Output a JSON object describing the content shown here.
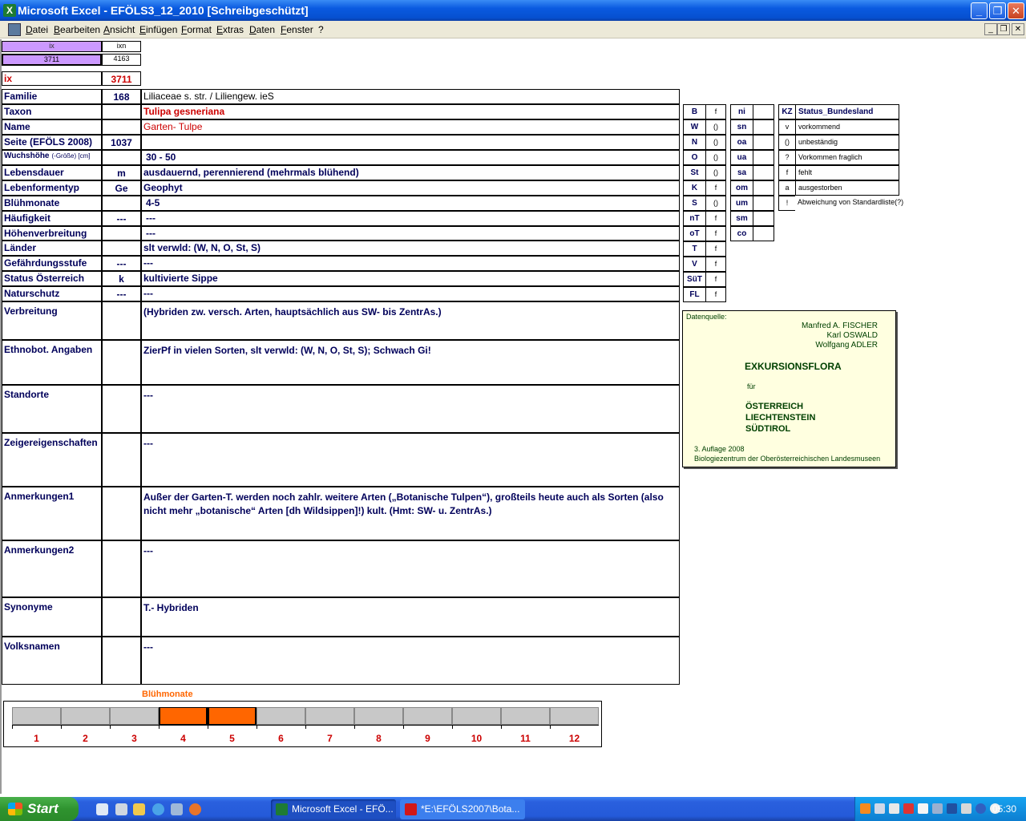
{
  "window": {
    "title": "Microsoft Excel - EFÖLS3_12_2010  [Schreibgeschützt]",
    "minimize": "_",
    "restore": "❐",
    "close": "✕"
  },
  "menu": [
    "Datei",
    "Bearbeiten",
    "Ansicht",
    "Einfügen",
    "Format",
    "Extras",
    "Daten",
    "Fenster",
    "?"
  ],
  "mdi": {
    "minimize": "_",
    "restore": "❐",
    "close": "✕"
  },
  "topcells": {
    "ix_head": "ix",
    "ixn_head": "ixn",
    "ix_val": "3711",
    "ixn_val": "4163"
  },
  "ix_row": {
    "label": "ix",
    "value": "3711"
  },
  "fields": [
    {
      "label": "Familie",
      "code": "168",
      "value": "Liliaceae s. str. / Liliengew. ieS"
    },
    {
      "label": "Taxon",
      "code": "",
      "value": "Tulipa gesneriana"
    },
    {
      "label": "Name",
      "code": "",
      "value": "Garten- Tulpe"
    },
    {
      "label": "Seite (EFÖLS 2008)",
      "code": "1037",
      "value": ""
    },
    {
      "label": "Wuchshöhe",
      "label_small": "(-Größe) [cm]",
      "code": "",
      "value": "30 - 50"
    },
    {
      "label": "Lebensdauer",
      "code": "m",
      "value": "ausdauernd, perennierend (mehrmals blühend)"
    },
    {
      "label": "Lebenformentyp",
      "code": "Ge",
      "value": "Geophyt"
    },
    {
      "label": "Blühmonate",
      "code": "",
      "value": "4-5"
    },
    {
      "label": "Häufigkeit",
      "code": "---",
      "value": "---"
    },
    {
      "label": "Höhenverbreitung",
      "code": "",
      "value": "---"
    },
    {
      "label": "Länder",
      "code": "",
      "value": "slt verwld: (W, N, O, St, S)"
    },
    {
      "label": "Gefährdungsstufe",
      "code": "---",
      "value": "---"
    },
    {
      "label": "Status Österreich",
      "code": "k",
      "value": "kultivierte Sippe"
    },
    {
      "label": "Naturschutz",
      "code": "---",
      "value": "---"
    }
  ],
  "bigfields": [
    {
      "label": "Verbreitung",
      "value": "(Hybriden zw. versch. Arten, hauptsächlich aus SW- bis ZentrAs.)"
    },
    {
      "label": "Ethnobot. Angaben",
      "value": "ZierPf in vielen Sorten, slt verwld: (W, N, O, St, S); Schwach Gi!"
    },
    {
      "label": "Standorte",
      "value": "---"
    },
    {
      "label": "Zeigereigenschaften",
      "value": "---"
    },
    {
      "label": "Anmerkungen1",
      "value": "Außer der Garten-T. werden noch zahlr. weitere Arten („Botanische Tulpen“), großteils heute auch als Sorten (also",
      "value2": "nicht mehr „botanische“ Arten [dh Wildsippen]!) kult. (Hmt: SW- u. ZentrAs.)"
    },
    {
      "label": "Anmerkungen2",
      "value": "---"
    },
    {
      "label": "Synonyme",
      "value": "T.- Hybriden"
    },
    {
      "label": "Volksnamen",
      "value": "---"
    }
  ],
  "laender": [
    {
      "code": "B",
      "val": "f"
    },
    {
      "code": "W",
      "val": "()"
    },
    {
      "code": "N",
      "val": "()"
    },
    {
      "code": "O",
      "val": "()"
    },
    {
      "code": "St",
      "val": "()"
    },
    {
      "code": "K",
      "val": "f"
    },
    {
      "code": "S",
      "val": "()"
    },
    {
      "code": "nT",
      "val": "f"
    },
    {
      "code": "oT",
      "val": "f"
    },
    {
      "code": "T",
      "val": "f"
    },
    {
      "code": "V",
      "val": "f"
    },
    {
      "code": "SüT",
      "val": "f"
    },
    {
      "code": "FL",
      "val": "f"
    }
  ],
  "regions": [
    {
      "code": "ni",
      "val": ""
    },
    {
      "code": "sn",
      "val": ""
    },
    {
      "code": "oa",
      "val": ""
    },
    {
      "code": "ua",
      "val": ""
    },
    {
      "code": "sa",
      "val": ""
    },
    {
      "code": "om",
      "val": ""
    },
    {
      "code": "um",
      "val": ""
    },
    {
      "code": "sm",
      "val": ""
    },
    {
      "code": "co",
      "val": ""
    }
  ],
  "legend": {
    "head_kz": "KZ",
    "head_status": "Status_Bundesland",
    "rows": [
      {
        "kz": "v",
        "text": "vorkommend"
      },
      {
        "kz": "()",
        "text": "unbeständig"
      },
      {
        "kz": "?",
        "text": "Vorkommen fraglich"
      },
      {
        "kz": "f",
        "text": "fehlt"
      },
      {
        "kz": "a",
        "text": "ausgestorben"
      },
      {
        "kz": "!",
        "text": "Abweichung von Standardliste(?)"
      }
    ]
  },
  "datenquelle": {
    "label": "Datenquelle:",
    "authors": [
      "Manfred A. FISCHER",
      "Karl OSWALD",
      "Wolfgang ADLER"
    ],
    "title": "EXKURSIONSFLORA",
    "fuer": "für",
    "countries": [
      "ÖSTERREICH",
      "LIECHTENSTEIN",
      "SÜDTIROL"
    ],
    "edition": "3. Auflage 2008",
    "publisher": "Biologiezentrum der Oberösterreichischen Landesmuseen"
  },
  "bluehmonate_chart": {
    "title": "Blühmonate",
    "months": [
      "1",
      "2",
      "3",
      "4",
      "5",
      "6",
      "7",
      "8",
      "9",
      "10",
      "11",
      "12"
    ],
    "flowering": [
      4,
      5
    ],
    "color_on": "#ff6600",
    "color_off": "#c8c8c8"
  },
  "taskbar": {
    "start": "Start",
    "tasks": [
      "Microsoft Excel - EFÖ...",
      "*E:\\EFÖLS2007\\Bota..."
    ],
    "clock": "05:30"
  }
}
